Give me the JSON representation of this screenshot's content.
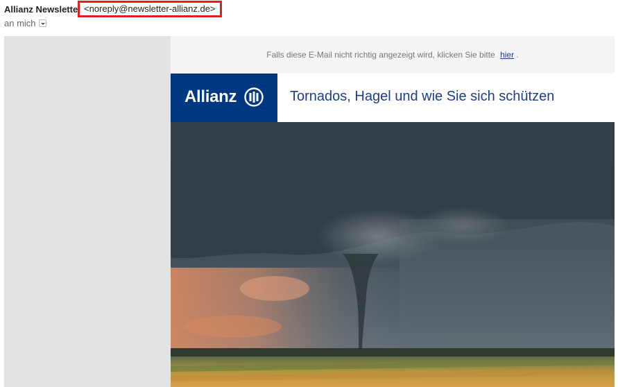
{
  "header": {
    "sender_name": "Allianz Newsletter",
    "sender_email": "<noreply@newsletter-allianz.de>",
    "recipient": "an mich"
  },
  "email": {
    "preheader_text": "Falls diese E-Mail nicht richtig angezeigt wird, klicken Sie bitte",
    "preheader_link": "hier",
    "preheader_suffix": ".",
    "logo_text": "Allianz",
    "headline": "Tornados, Hagel und wie Sie sich schützen"
  },
  "colors": {
    "brand_blue": "#003781",
    "headline_blue": "#1d3d8c",
    "highlight_red": "#e02020"
  }
}
